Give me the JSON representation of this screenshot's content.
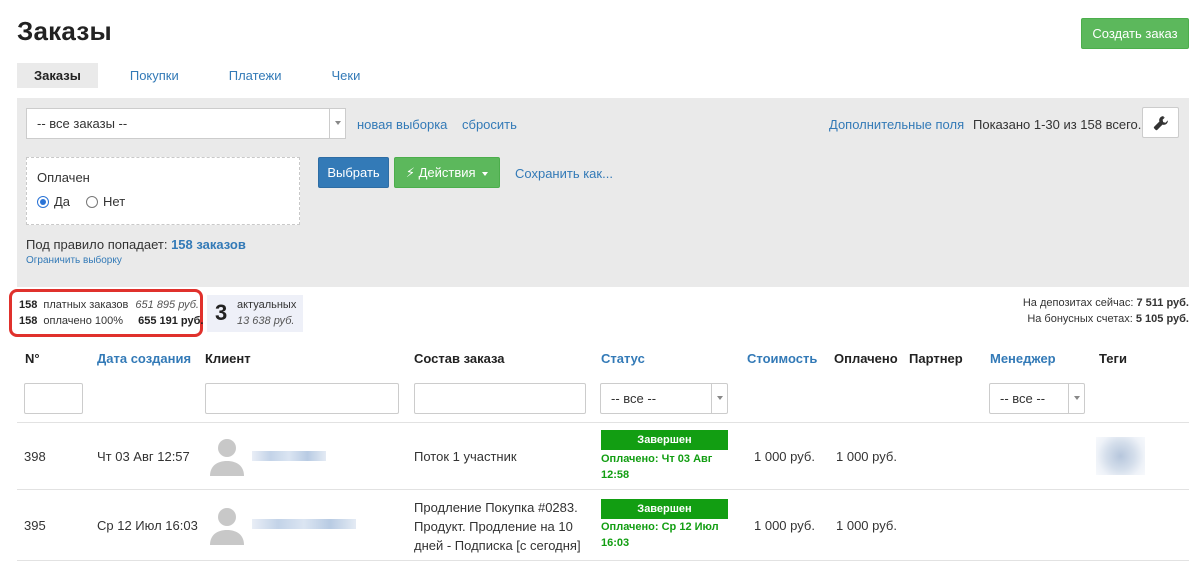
{
  "page": {
    "title": "Заказы",
    "create_button": "Создать заказ"
  },
  "tabs": [
    {
      "label": "Заказы",
      "active": true
    },
    {
      "label": "Покупки",
      "active": false
    },
    {
      "label": "Платежи",
      "active": false
    },
    {
      "label": "Чеки",
      "active": false
    }
  ],
  "filter": {
    "selection_value": "-- все заказы --",
    "new_selection": "новая выборка",
    "reset": "сбросить",
    "extra_fields": "Дополнительные поля",
    "shown_text": "Показано 1-30 из 158 всего.",
    "tool_icon": "wrench-icon",
    "condition": {
      "label": "Оплачен",
      "options": [
        {
          "label": "Да",
          "selected": true
        },
        {
          "label": "Нет",
          "selected": false
        }
      ]
    },
    "select_button": "Выбрать",
    "actions_button": "Действия",
    "save_as": "Сохранить как...",
    "rule_prefix": "Под правило попадает:",
    "rule_count": "158 заказов",
    "limit_link": "Ограничить выборку"
  },
  "summary": {
    "paid_orders_count": "158",
    "paid_orders_label": "платных заказов",
    "paid_orders_sum": "651 895 руб.",
    "paid_count": "158",
    "paid_label": "оплачено 100%",
    "paid_sum": "655 191 руб.",
    "actual_count": "3",
    "actual_label": "актуальных",
    "actual_sum": "13 638 руб.",
    "deposits_label": "На депозитах сейчас:",
    "deposits_value": "7 511 руб.",
    "bonus_label": "На бонусных счетах:",
    "bonus_value": "5 105 руб."
  },
  "table": {
    "columns": {
      "num": "N°",
      "created": "Дата создания",
      "client": "Клиент",
      "composition": "Состав заказа",
      "status": "Статус",
      "cost": "Стоимость",
      "paid": "Оплачено",
      "partner": "Партнер",
      "manager": "Менеджер",
      "tags": "Теги"
    },
    "status_filter": "-- все --",
    "manager_filter": "-- все --",
    "rows": [
      {
        "id": "398",
        "created": "Чт 03 Авг 12:57",
        "composition": "Поток 1 участник",
        "status": "Завершен",
        "paid_info": "Оплачено: Чт 03 Авг 12:58",
        "cost": "1 000 руб.",
        "paid": "1 000 руб."
      },
      {
        "id": "395",
        "created": "Ср 12 Июл 16:03",
        "composition": "Продление Покупка #0283. Продукт. Продление на 10 дней - Подписка [с сегодня]",
        "status": "Завершен",
        "paid_info": "Оплачено: Ср 12 Июл 16:03",
        "cost": "1 000 руб.",
        "paid": "1 000 руб."
      }
    ]
  },
  "colors": {
    "link": "#337ab7",
    "success": "#5cb85c",
    "primary": "#337ab7",
    "status_green": "#129e12",
    "highlight": "#e0312c"
  }
}
